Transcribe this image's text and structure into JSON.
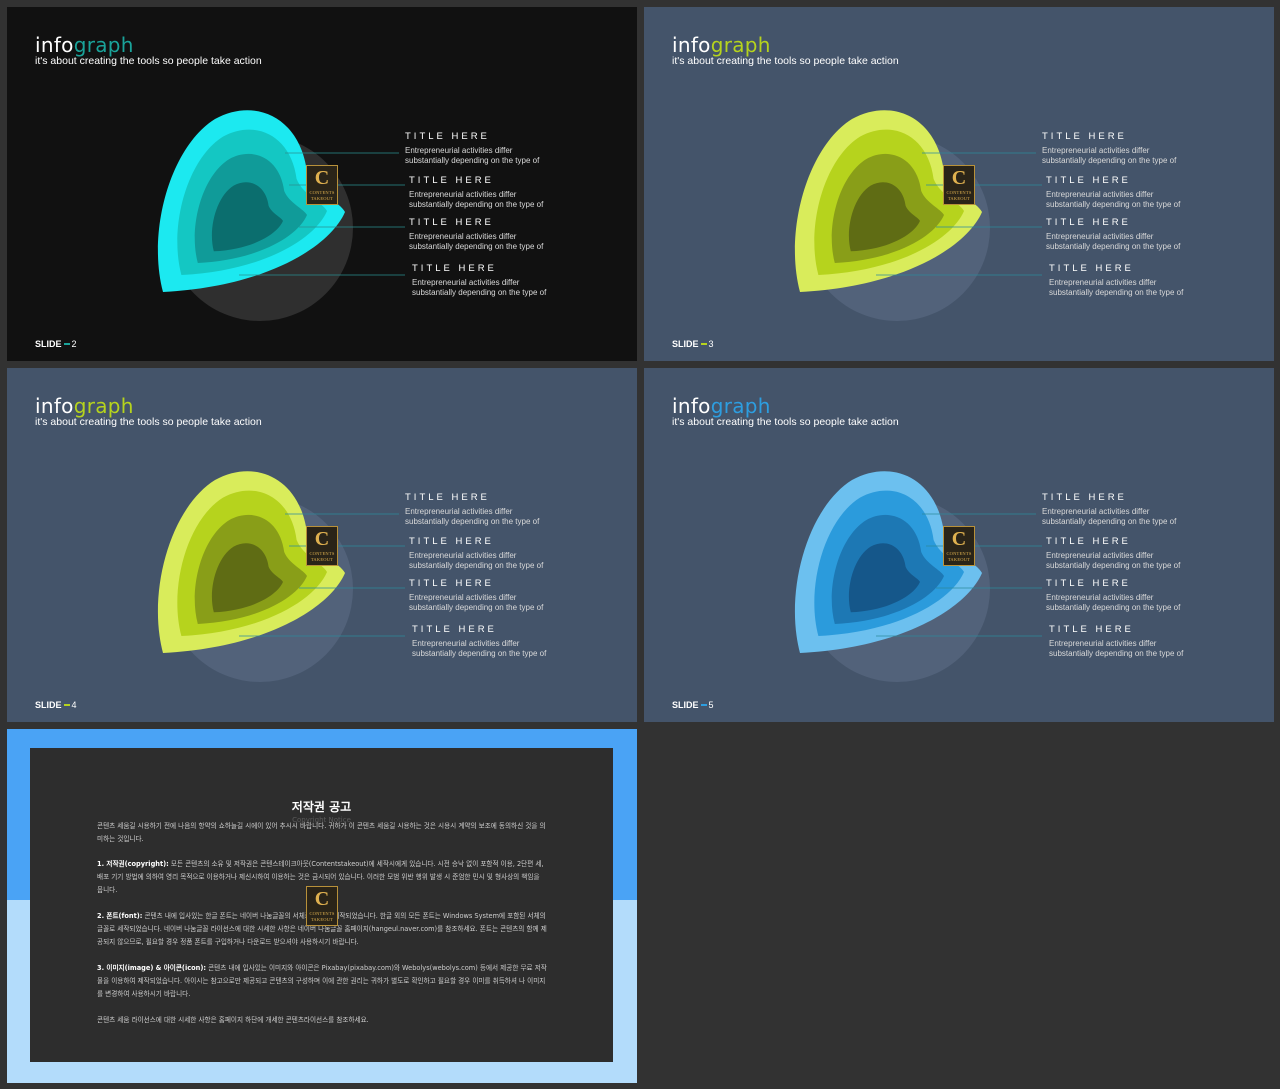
{
  "slides": [
    {
      "title_a": "info",
      "title_b": "graph",
      "subtitle": "it's about creating the tools so people take action",
      "footer_label": "SLIDE",
      "footer_num": "2",
      "accent": "#1aa39a",
      "colors": {
        "bg": "#111111",
        "circle": "#2f2f2f",
        "l1": "#1ce9f0",
        "l2": "#14c7c3",
        "l3": "#109b99",
        "l4": "#0b6e6e",
        "line": "#2a8e91"
      }
    },
    {
      "title_a": "info",
      "title_b": "graph",
      "subtitle": "it's about creating the tools so people take action",
      "footer_label": "SLIDE",
      "footer_num": "3",
      "accent": "#b6d31d",
      "colors": {
        "bg": "#44546a",
        "circle": "#52627a",
        "l1": "#d9ec5b",
        "l2": "#b6d31d",
        "l3": "#899e18",
        "l4": "#5f6c14",
        "line": "#2d8a9c"
      }
    },
    {
      "title_a": "info",
      "title_b": "graph",
      "subtitle": "it's about creating the tools so people take action",
      "footer_label": "SLIDE",
      "footer_num": "4",
      "accent": "#b6d31d",
      "colors": {
        "bg": "#44546a",
        "circle": "#52627a",
        "l1": "#d9ec5b",
        "l2": "#b6d31d",
        "l3": "#899e18",
        "l4": "#5f6c14",
        "line": "#2d8a9c"
      }
    },
    {
      "title_a": "info",
      "title_b": "graph",
      "subtitle": "it's about creating the tools so people take action",
      "footer_label": "SLIDE",
      "footer_num": "5",
      "accent": "#2d9ee0",
      "colors": {
        "bg": "#44546a",
        "circle": "#52627a",
        "l1": "#6cc0ef",
        "l2": "#2b9bdc",
        "l3": "#1d78b4",
        "l4": "#15578a",
        "line": "#2d8a9c"
      }
    }
  ],
  "items": [
    {
      "title": "TITLE HERE",
      "desc1": "Entrepreneurial activities differ",
      "desc2": "substantially depending on the type of"
    },
    {
      "title": "TITLE HERE",
      "desc1": "Entrepreneurial activities differ",
      "desc2": "substantially depending on the type of"
    },
    {
      "title": "TITLE HERE",
      "desc1": "Entrepreneurial activities differ",
      "desc2": "substantially depending on the type of"
    },
    {
      "title": "TITLE HERE",
      "desc1": "Entrepreneurial activities differ",
      "desc2": "substantially depending on the type of"
    }
  ],
  "logo": {
    "letter": "C",
    "line1": "CONTENTS",
    "line2": "TAKEOUT"
  },
  "notice": {
    "title": "저작권 공고",
    "subtitle": "Copyright Notice",
    "intro": "콘텐츠 세움길 시용하기 전에 나음의 항약의 쇼하늘길 시에이 있어 추시시 바랍니다. 귀하가 이 콘텐츠 세움길 시용하는 것은 시용시 계약의 보조에 동의하신 것을 의미하는 것입니다.",
    "p1_head": "1. 저작권(copyright):",
    "p1_body": " 모든 콘텐츠의 소유 및 저작권은 콘텐스테이크아웃(Contentstakeout)에 세작시에게 있습니다. 시전 승낙 없이 포함적 이용, 2단편 세, 배포 기기 방법에 의하여 영리 목적으로 이용하거나 제신시하여 이용하는 것은 금시되어 있습니다. 이러한 모범 위반 행위 발생 시 준엄한 민시 및 형사상의 책임을 뭅니다.",
    "p2_head": "2. 폰트(font):",
    "p2_body": " 콘텐츠 내에 입사있는 한글 폰트는 네이버 나눔글꼴의 서체로 만들어 세작되었습니다. 한글 외의 모든 폰트는 Windows System에 포함된 서체의 글꼴로 세작되었습니다. 네이버 나눔글꼴 라이선스에 대한 시세한 사항은 네이버 나눔글꼴 홈페이지(hangeul.naver.com)를 참조하세요. 폰트는 콘텐츠의 함께 제공되지 않으므로, 필요할 경우 정품 폰트를 구입하거나 다운로드 받으셔야 사용하시기 바랍니다.",
    "p3_head": "3. 이미지(image) & 아이콘(icon):",
    "p3_body": " 콘텐츠 내에 입사있는 이미지와 아이콘은 Pixabay(pixabay.com)와 Webolys(webolys.com) 등에서 제공한 무료 저작물을 이용하여 제작되었습니다. 아이시는 참고으로만 제공되고 콘텐츠의 구성하며 이에 관한 권리는 귀하가 별도로 확인하고 필요할 경우 이미를 취득하셔 나 이미지를 변경하여 사용하시기 바랍니다.",
    "outro": "콘텐츠 세움 라이선스에 대한 시세한 사항은 홈페이지 하단에 개세한 콘텐츠라이선스를 참조하세요."
  }
}
